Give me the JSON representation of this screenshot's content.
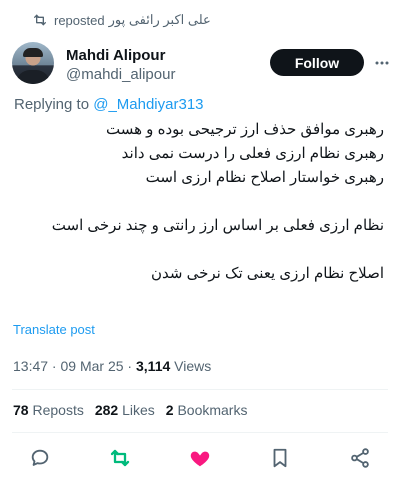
{
  "repost_banner": {
    "reposter": "علی اکبر رائفی پور",
    "suffix": "reposted"
  },
  "author": {
    "display_name": "Mahdi Alipour",
    "handle": "@mahdi_alipour"
  },
  "follow_label": "Follow",
  "replying": {
    "prefix": "Replying to",
    "mention": "@_Mahdiyar313"
  },
  "body_lines": [
    "رهبری موافق حذف ارز ترجیحی بوده و هست",
    "رهبری نظام ارزی فعلی را درست نمی داند",
    "رهبری خواستار اصلاح نظام ارزی است",
    "",
    "نظام ارزی فعلی بر اساس ارز رانتی و چند نرخی است",
    "",
    "اصلاح نظام ارزی یعنی تک نرخی شدن"
  ],
  "translate_label": "Translate post",
  "meta": {
    "time": "13:47",
    "sep1": " · ",
    "date": "09 Mar 25",
    "sep2": " · ",
    "views_count": "3,114",
    "views_label": " Views"
  },
  "stats": {
    "reposts_count": "78",
    "reposts_label": "Reposts",
    "likes_count": "282",
    "likes_label": "Likes",
    "bookmarks_count": "2",
    "bookmarks_label": "Bookmarks"
  },
  "colors": {
    "link": "#1d9bf0",
    "repost_active": "#00ba7c",
    "like_active": "#f91880",
    "muted": "#536471"
  },
  "icons": [
    "repost-icon",
    "more-icon",
    "reply-icon",
    "like-icon",
    "bookmark-icon",
    "share-icon"
  ]
}
